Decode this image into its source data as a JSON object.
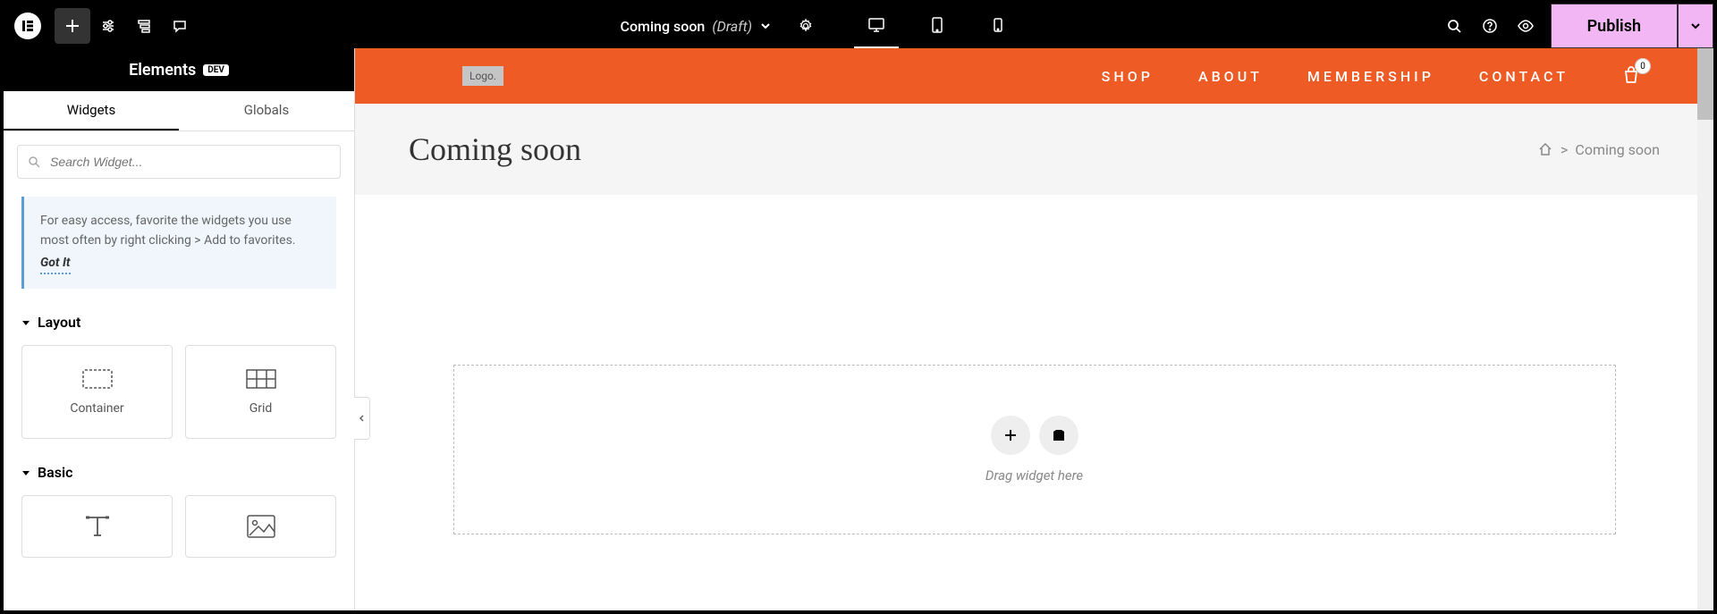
{
  "topbar": {
    "page_title": "Coming soon",
    "page_status": "(Draft)",
    "publish_label": "Publish"
  },
  "sidebar": {
    "title": "Elements",
    "badge": "DEV",
    "tabs": {
      "widgets": "Widgets",
      "globals": "Globals"
    },
    "search_placeholder": "Search Widget...",
    "tip_text": "For easy access, favorite the widgets you use most often by right clicking > Add to favorites.",
    "tip_link": "Got It",
    "sections": {
      "layout": {
        "title": "Layout",
        "items": [
          "Container",
          "Grid"
        ]
      },
      "basic": {
        "title": "Basic"
      }
    }
  },
  "site": {
    "logo_text": "Logo.",
    "nav": [
      "SHOP",
      "ABOUT",
      "MEMBERSHIP",
      "CONTACT"
    ],
    "cart_count": "0"
  },
  "page": {
    "heading": "Coming soon",
    "breadcrumb_sep": ">",
    "breadcrumb_current": "Coming soon"
  },
  "canvas": {
    "drop_hint": "Drag widget here"
  }
}
